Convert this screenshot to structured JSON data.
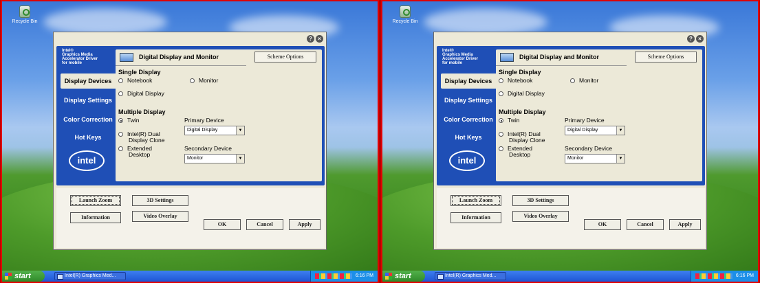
{
  "desktop": {
    "recycle_bin_label": "Recycle Bin"
  },
  "window": {
    "brand_lines": [
      "Intel®",
      "Graphics Media",
      "Accelerator Driver",
      "for mobile"
    ],
    "nav": [
      {
        "label": "Display Devices",
        "active": true
      },
      {
        "label": "Display Settings",
        "active": false
      },
      {
        "label": "Color Correction",
        "active": false
      },
      {
        "label": "Hot Keys",
        "active": false
      }
    ],
    "logo_text": "intel",
    "header_title": "Digital Display and Monitor",
    "scheme_options_label": "Scheme Options",
    "single_display": {
      "label": "Single Display",
      "notebook": "Notebook",
      "monitor": "Monitor",
      "digital_display": "Digital Display"
    },
    "multiple_display": {
      "label": "Multiple Display",
      "twin": "Twin",
      "dual_clone_line1": "Intel(R) Dual",
      "dual_clone_line2": "Display Clone",
      "extended_line1": "Extended",
      "extended_line2": "Desktop"
    },
    "primary_device": {
      "label": "Primary Device",
      "value": "Digital Display"
    },
    "secondary_device": {
      "label": "Secondary Device",
      "value": "Monitor"
    },
    "buttons": {
      "launch_zoom": "Launch Zoom",
      "settings_3d": "3D Settings",
      "information": "Information",
      "video_overlay": "Video Overlay",
      "ok": "OK",
      "cancel": "Cancel",
      "apply": "Apply"
    }
  },
  "taskbar": {
    "start_label": "start",
    "task_label": "Intel(R) Graphics Med...",
    "clock": "6:16 PM"
  }
}
